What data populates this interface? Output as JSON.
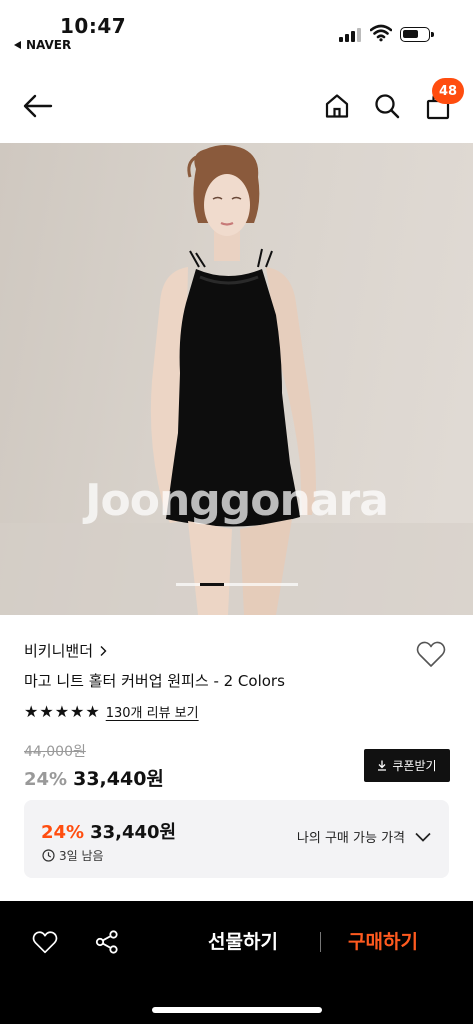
{
  "status_bar": {
    "time": "10:47",
    "back_app": "NAVER"
  },
  "nav": {
    "back_icon": "arrow-left-icon",
    "home_icon": "home-icon",
    "search_icon": "search-icon",
    "cart_icon": "shopping-bag-icon",
    "cart_count": "48"
  },
  "hero": {
    "watermark": "Joonggonara",
    "page_count": 5,
    "current_page": 2
  },
  "product": {
    "brand": "비키니밴더",
    "title": "마고 니트 홀터 커버업 원피스 - 2 Colors",
    "rating": 5,
    "review_link": "130개 리뷰 보기",
    "original_price": "44,000원",
    "discount": "24%",
    "price": "33,440원",
    "coupon_button": "쿠폰받기"
  },
  "deal": {
    "discount": "24%",
    "price": "33,440원",
    "remaining": "3일 남음",
    "toggle_label": "나의 구매 가능 가격"
  },
  "bottom_bar": {
    "gift_button": "선물하기",
    "buy_button": "구매하기"
  },
  "colors": {
    "accent": "#ff4d0f",
    "buy": "#ff5a1f",
    "bar": "#000000"
  }
}
